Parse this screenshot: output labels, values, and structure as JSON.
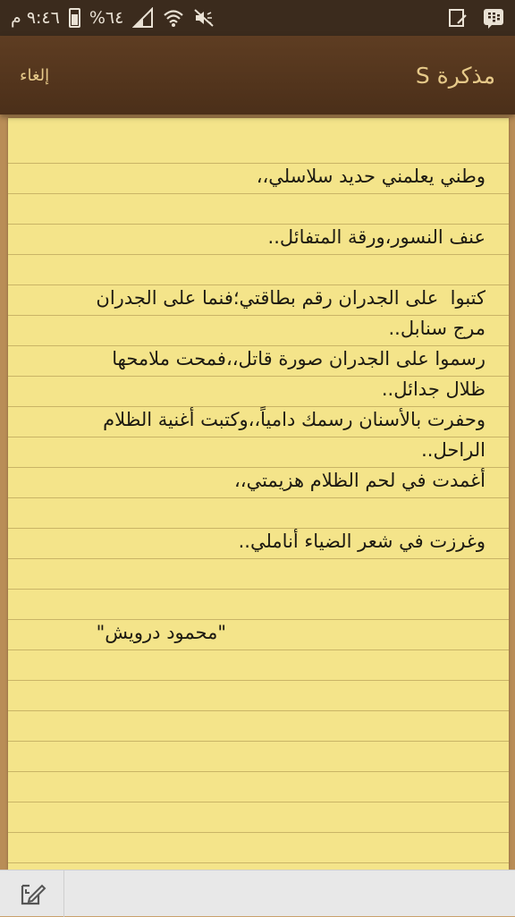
{
  "status_bar": {
    "time": "٩:٤٦ م",
    "battery": "%٦٤"
  },
  "action_bar": {
    "cancel_label": "إلغاء",
    "title": "مذكرة S"
  },
  "note": {
    "lines": [
      "وطني يعلمني حديد سلاسلي،،",
      "",
      "عنف النسور،ورقة المتفائل..",
      "",
      "كتبوا  على الجدران رقم بطاقتي؛فنما على الجدران",
      "مرج سنابل..",
      "رسموا على الجدران صورة قاتل،،فمحت ملامحها",
      "ظلال جدائل..",
      "وحفرت بالأسنان رسمك دامياً،،وكتبت أغنية الظلام",
      "الراحل..",
      "أغمدت في لحم الظلام هزيمتي،،",
      "",
      "وغرزت في شعر الضياء أناملي..",
      "",
      "",
      "\"محمود درويش\""
    ]
  }
}
